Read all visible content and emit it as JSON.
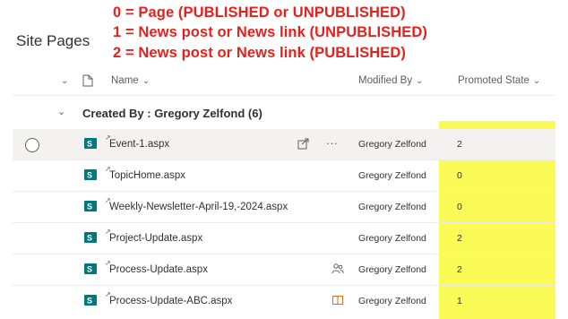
{
  "annotations": [
    "0 = Page (PUBLISHED or UNPUBLISHED)",
    "1 = News post or News link (UNPUBLISHED)",
    "2 = News post or News link (PUBLISHED)"
  ],
  "library_title": "Site Pages",
  "columns": {
    "name": "Name",
    "modified_by": "Modified By",
    "promoted_state": "Promoted State"
  },
  "group": {
    "label": "Created By : Gregory Zelfond (6)"
  },
  "rows": [
    {
      "name": "Event-1.aspx",
      "modified_by": "Gregory Zelfond",
      "promoted_state": "2"
    },
    {
      "name": "TopicHome.aspx",
      "modified_by": "Gregory Zelfond",
      "promoted_state": "0"
    },
    {
      "name": "Weekly-Newsletter-April-19,-2024.aspx",
      "modified_by": "Gregory Zelfond",
      "promoted_state": "0"
    },
    {
      "name": "Project-Update.aspx",
      "modified_by": "Gregory Zelfond",
      "promoted_state": "2"
    },
    {
      "name": "Process-Update.aspx",
      "modified_by": "Gregory Zelfond",
      "promoted_state": "2"
    },
    {
      "name": "Process-Update-ABC.aspx",
      "modified_by": "Gregory Zelfond",
      "promoted_state": "1"
    }
  ],
  "colors": {
    "annotation": "#e8201c",
    "highlight": "#fbfb58",
    "sharepoint_green": "#03787c"
  },
  "icons": {
    "file_type": "sharepoint-page-icon",
    "header_file": "document-outline-icon",
    "share": "share-icon",
    "more": "ellipsis-icon",
    "shared_with": "people-icon",
    "checkout": "book-open-icon"
  }
}
